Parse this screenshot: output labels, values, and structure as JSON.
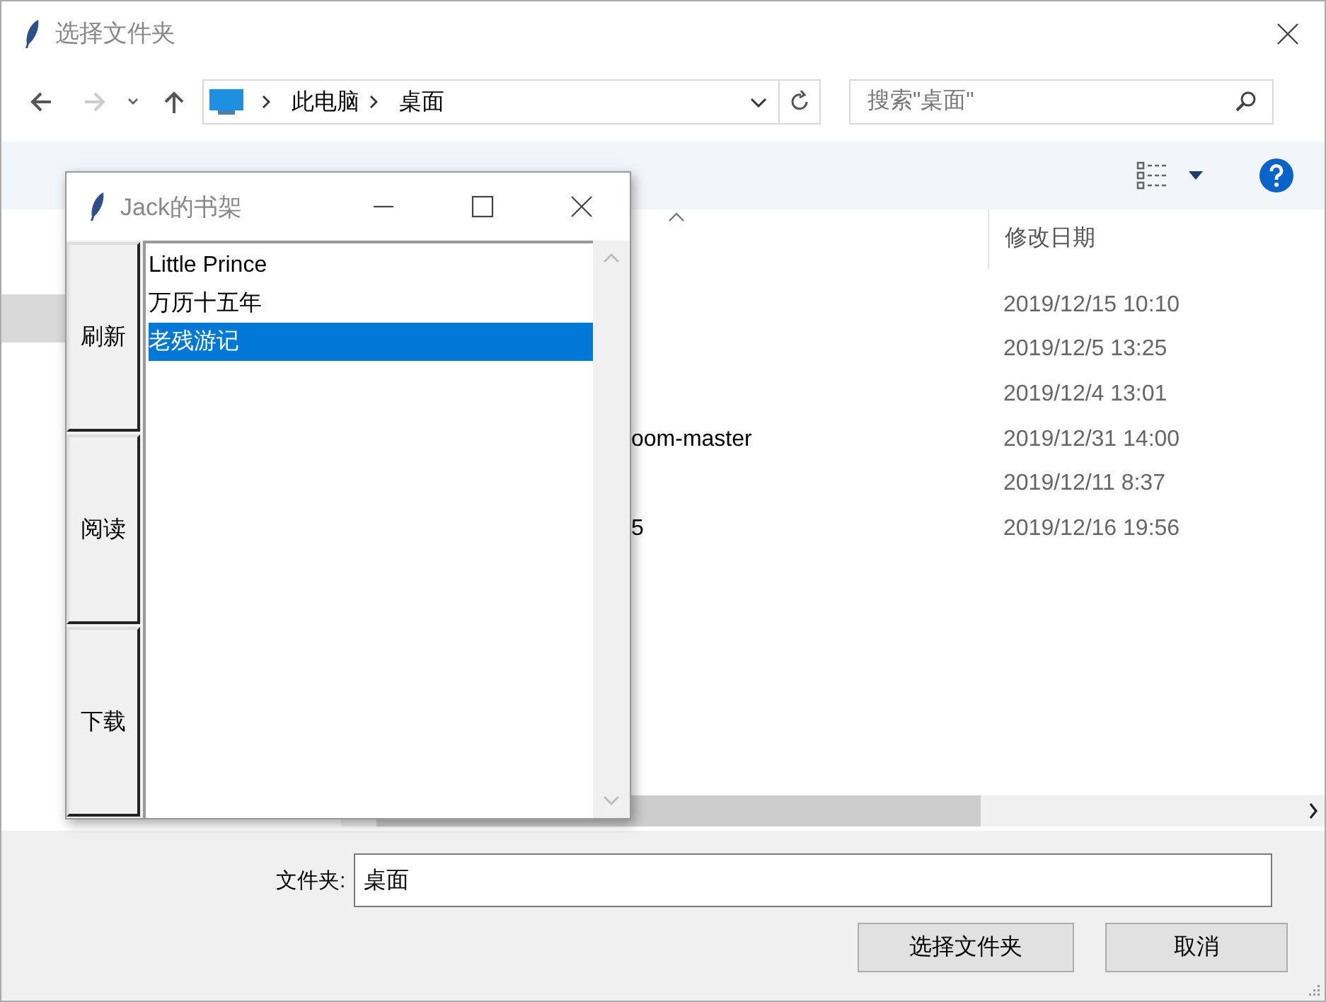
{
  "dialog": {
    "title": "选择文件夹",
    "address": {
      "path": [
        "此电脑",
        "桌面"
      ]
    },
    "search": {
      "placeholder": "搜索\"桌面\""
    },
    "columns": [
      {
        "label": "修改日期"
      }
    ],
    "files": [
      {
        "modified": "2019/12/15 10:10"
      },
      {
        "modified": "2019/12/5 13:25"
      },
      {
        "modified": "2019/12/4 13:01"
      },
      {
        "name": "oom-master",
        "modified": "2019/12/31 14:00"
      },
      {
        "modified": "2019/12/11 8:37"
      },
      {
        "name": "5",
        "modified": "2019/12/16 19:56"
      }
    ],
    "folder_label": "文件夹:",
    "folder_value": "桌面",
    "buttons": [
      "选择文件夹",
      "取消"
    ]
  },
  "overlay": {
    "title": "Jack的书架",
    "buttons": [
      "刷新",
      "阅读",
      "下载"
    ],
    "books": [
      {
        "title": "Little Prince",
        "selected": false
      },
      {
        "title": "万历十五年",
        "selected": false
      },
      {
        "title": "老残游记",
        "selected": true
      }
    ]
  }
}
